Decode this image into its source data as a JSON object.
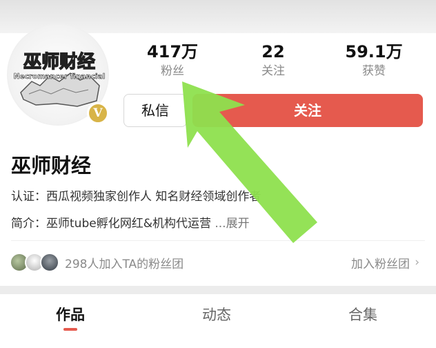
{
  "profile": {
    "avatar_text_main": "巫师财经",
    "avatar_text_sub": "Necromancer financial",
    "verify_badge": "V",
    "name": "巫师财经",
    "certification": "认证：西瓜视频独家创作人 知名财经领域创作者",
    "intro": "简介：巫师tube孵化网红&机构代运营 ",
    "intro_more": "...展开"
  },
  "stats": [
    {
      "value": "417万",
      "label": "粉丝"
    },
    {
      "value": "22",
      "label": "关注"
    },
    {
      "value": "59.1万",
      "label": "获赞"
    }
  ],
  "actions": {
    "message_label": "私信",
    "follow_label": "关注"
  },
  "fan_group": {
    "text": "298人加入TA的粉丝团",
    "join_label": "加入粉丝团",
    "chevron": "›"
  },
  "tabs": [
    {
      "label": "作品",
      "active": true
    },
    {
      "label": "动态",
      "active": false
    },
    {
      "label": "合集",
      "active": false
    }
  ],
  "colors": {
    "follow_button": "#e55a4e",
    "annotation_arrow": "#8ee04e",
    "verify_badge": "#d8b448"
  },
  "icons": {
    "verify": "verified-v-icon",
    "chevron": "chevron-right-icon",
    "annotation": "green-arrow-annotation"
  }
}
